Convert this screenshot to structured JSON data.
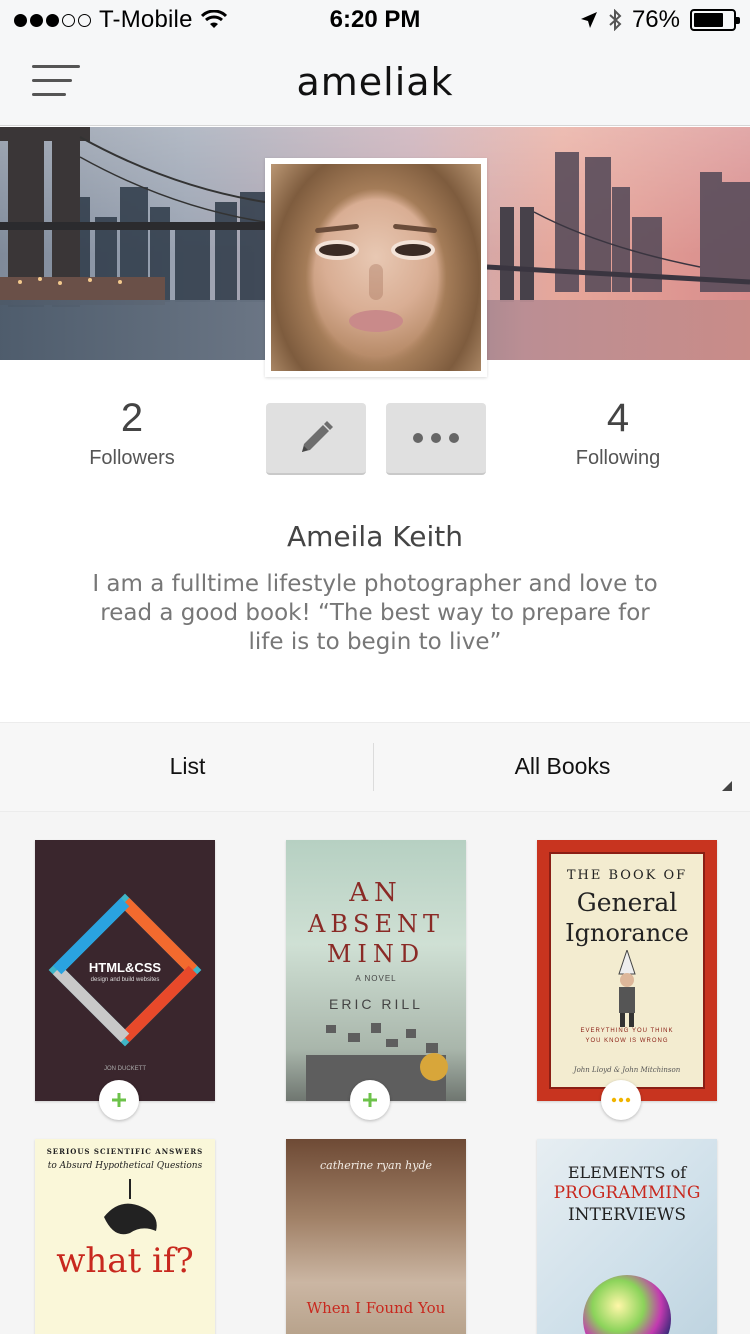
{
  "status_bar": {
    "carrier": "T-Mobile",
    "time": "6:20 PM",
    "battery": "76%",
    "battery_level": 0.76,
    "signal_bars": 3
  },
  "nav": {
    "title": "ameliak"
  },
  "profile": {
    "followers_count": "2",
    "followers_label": "Followers",
    "following_count": "4",
    "following_label": "Following",
    "name": "Ameila Keith",
    "bio": "I am a fulltime lifestyle photographer and love to read a good book! “The best way to prepare for life is to begin to live”"
  },
  "tabs": {
    "list_label": "List",
    "filter_label": "All Books"
  },
  "books": [
    {
      "title": "HTML&CSS",
      "subtitle": "design and build websites",
      "author": "JON DUCKETT",
      "action": "add"
    },
    {
      "title_lines": [
        "AN",
        "ABSENT",
        "MIND"
      ],
      "kicker": "A NOVEL",
      "author": "ERIC RILL",
      "action": "add"
    },
    {
      "top": "THE BOOK OF",
      "title_lines": [
        "General",
        "Ignorance"
      ],
      "tagline_lines": [
        "EVERYTHING YOU THINK",
        "YOU KNOW IS WRONG"
      ],
      "author": "John Lloyd & John Mitchinson",
      "action": "more"
    },
    {
      "top_lines": [
        "SERIOUS SCIENTIFIC ANSWERS",
        "to Absurd Hypothetical Questions"
      ],
      "title": "what if?"
    },
    {
      "author": "catherine ryan hyde",
      "title": "When I Found You"
    },
    {
      "title_lines": [
        "ELEMENTS of",
        "PROGRAMMING",
        "INTERVIEWS"
      ]
    }
  ],
  "icons": {
    "menu": "hamburger-icon",
    "edit": "pencil-icon",
    "more": "ellipsis-icon",
    "add": "plus-icon",
    "dropdown": "triangle-icon"
  },
  "colors": {
    "add_green": "#6cc24a",
    "more_yellow": "#f0b400"
  }
}
